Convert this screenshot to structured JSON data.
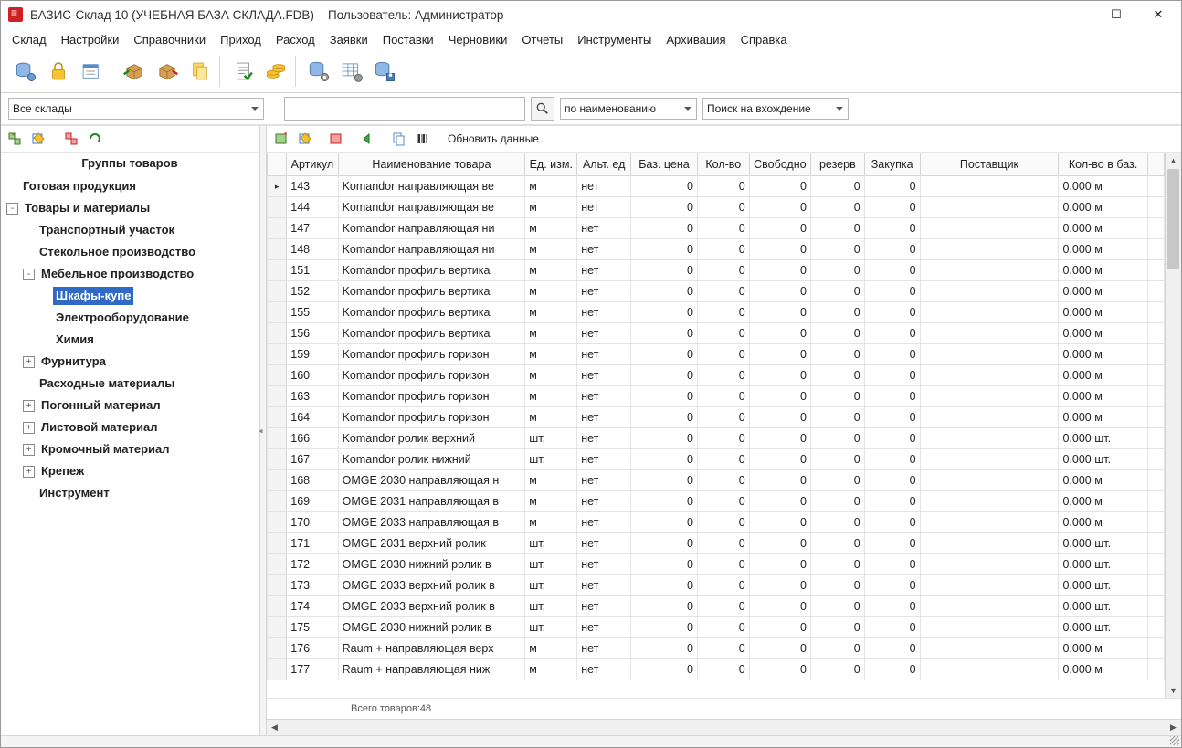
{
  "title_full": "БАЗИС-Склад 10 (УЧЕБНАЯ БАЗА СКЛАДА.FDB)    Пользователь: Администратор",
  "menu": [
    "Склад",
    "Настройки",
    "Справочники",
    "Приход",
    "Расход",
    "Заявки",
    "Поставки",
    "Черновики",
    "Отчеты",
    "Инструменты",
    "Архивация",
    "Справка"
  ],
  "filter": {
    "warehouse": "Все склады",
    "search_value": "",
    "mode": "по наименованию",
    "match": "Поиск на вхождение"
  },
  "tree_title": "Группы товаров",
  "tree": [
    {
      "d": 0,
      "exp": "",
      "label": "Готовая продукция",
      "bold": true
    },
    {
      "d": 0,
      "exp": "-",
      "label": "Товары и материалы",
      "bold": true
    },
    {
      "d": 1,
      "exp": "",
      "label": "Транспортный участок",
      "bold": true
    },
    {
      "d": 1,
      "exp": "",
      "label": "Стекольное производство",
      "bold": true
    },
    {
      "d": 1,
      "exp": "-",
      "label": "Мебельное производство",
      "bold": true
    },
    {
      "d": 2,
      "exp": "",
      "label": "Шкафы-купе",
      "bold": true,
      "sel": true
    },
    {
      "d": 2,
      "exp": "",
      "label": "Электрооборудование",
      "bold": true
    },
    {
      "d": 2,
      "exp": "",
      "label": "Химия",
      "bold": true
    },
    {
      "d": 1,
      "exp": "+",
      "label": "Фурнитура",
      "bold": true
    },
    {
      "d": 1,
      "exp": "",
      "label": "Расходные материалы",
      "bold": true
    },
    {
      "d": 1,
      "exp": "+",
      "label": "Погонный материал",
      "bold": true
    },
    {
      "d": 1,
      "exp": "+",
      "label": "Листовой материал",
      "bold": true
    },
    {
      "d": 1,
      "exp": "+",
      "label": "Кромочный материал",
      "bold": true
    },
    {
      "d": 1,
      "exp": "+",
      "label": "Крепеж",
      "bold": true
    },
    {
      "d": 1,
      "exp": "",
      "label": "Инструмент",
      "bold": true
    }
  ],
  "right_toolbar_refresh": "Обновить данные",
  "columns": [
    "",
    "Артикул",
    "Наименование товара",
    "Ед. изм.",
    "Альт. ед",
    "Баз. цена",
    "Кол-во",
    "Свободно",
    "резерв",
    "Закупка",
    "Поставщик",
    "Кол-во в баз.",
    ""
  ],
  "rows": [
    {
      "art": "143",
      "name": "Komandor направляющая ве",
      "ed": "м",
      "alt": "нет",
      "price": "0",
      "qty": "0",
      "free": "0",
      "res": "0",
      "buy": "0",
      "supp": "",
      "base": "0.000 м",
      "mark": "▸"
    },
    {
      "art": "144",
      "name": "Komandor направляющая ве",
      "ed": "м",
      "alt": "нет",
      "price": "0",
      "qty": "0",
      "free": "0",
      "res": "0",
      "buy": "0",
      "supp": "",
      "base": "0.000 м"
    },
    {
      "art": "147",
      "name": "Komandor направляющая ни",
      "ed": "м",
      "alt": "нет",
      "price": "0",
      "qty": "0",
      "free": "0",
      "res": "0",
      "buy": "0",
      "supp": "",
      "base": "0.000 м"
    },
    {
      "art": "148",
      "name": "Komandor направляющая ни",
      "ed": "м",
      "alt": "нет",
      "price": "0",
      "qty": "0",
      "free": "0",
      "res": "0",
      "buy": "0",
      "supp": "",
      "base": "0.000 м"
    },
    {
      "art": "151",
      "name": "Komandor профиль вертика",
      "ed": "м",
      "alt": "нет",
      "price": "0",
      "qty": "0",
      "free": "0",
      "res": "0",
      "buy": "0",
      "supp": "",
      "base": "0.000 м"
    },
    {
      "art": "152",
      "name": "Komandor профиль вертика",
      "ed": "м",
      "alt": "нет",
      "price": "0",
      "qty": "0",
      "free": "0",
      "res": "0",
      "buy": "0",
      "supp": "",
      "base": "0.000 м"
    },
    {
      "art": "155",
      "name": "Komandor профиль вертика",
      "ed": "м",
      "alt": "нет",
      "price": "0",
      "qty": "0",
      "free": "0",
      "res": "0",
      "buy": "0",
      "supp": "",
      "base": "0.000 м"
    },
    {
      "art": "156",
      "name": "Komandor профиль вертика",
      "ed": "м",
      "alt": "нет",
      "price": "0",
      "qty": "0",
      "free": "0",
      "res": "0",
      "buy": "0",
      "supp": "",
      "base": "0.000 м"
    },
    {
      "art": "159",
      "name": "Komandor профиль горизон",
      "ed": "м",
      "alt": "нет",
      "price": "0",
      "qty": "0",
      "free": "0",
      "res": "0",
      "buy": "0",
      "supp": "",
      "base": "0.000 м"
    },
    {
      "art": "160",
      "name": "Komandor профиль горизон",
      "ed": "м",
      "alt": "нет",
      "price": "0",
      "qty": "0",
      "free": "0",
      "res": "0",
      "buy": "0",
      "supp": "",
      "base": "0.000 м"
    },
    {
      "art": "163",
      "name": "Komandor профиль горизон",
      "ed": "м",
      "alt": "нет",
      "price": "0",
      "qty": "0",
      "free": "0",
      "res": "0",
      "buy": "0",
      "supp": "",
      "base": "0.000 м"
    },
    {
      "art": "164",
      "name": "Komandor профиль горизон",
      "ed": "м",
      "alt": "нет",
      "price": "0",
      "qty": "0",
      "free": "0",
      "res": "0",
      "buy": "0",
      "supp": "",
      "base": "0.000 м"
    },
    {
      "art": "166",
      "name": "Komandor ролик верхний",
      "ed": "шт.",
      "alt": "нет",
      "price": "0",
      "qty": "0",
      "free": "0",
      "res": "0",
      "buy": "0",
      "supp": "",
      "base": "0.000 шт."
    },
    {
      "art": "167",
      "name": "Komandor ролик нижний",
      "ed": "шт.",
      "alt": "нет",
      "price": "0",
      "qty": "0",
      "free": "0",
      "res": "0",
      "buy": "0",
      "supp": "",
      "base": "0.000 шт."
    },
    {
      "art": "168",
      "name": "OMGE 2030 направляющая н",
      "ed": "м",
      "alt": "нет",
      "price": "0",
      "qty": "0",
      "free": "0",
      "res": "0",
      "buy": "0",
      "supp": "",
      "base": "0.000 м"
    },
    {
      "art": "169",
      "name": "OMGE 2031 направляющая в",
      "ed": "м",
      "alt": "нет",
      "price": "0",
      "qty": "0",
      "free": "0",
      "res": "0",
      "buy": "0",
      "supp": "",
      "base": "0.000 м"
    },
    {
      "art": "170",
      "name": "OMGE 2033 направляющая в",
      "ed": "м",
      "alt": "нет",
      "price": "0",
      "qty": "0",
      "free": "0",
      "res": "0",
      "buy": "0",
      "supp": "",
      "base": "0.000 м"
    },
    {
      "art": "171",
      "name": "OMGE 2031 верхний ролик",
      "ed": "шт.",
      "alt": "нет",
      "price": "0",
      "qty": "0",
      "free": "0",
      "res": "0",
      "buy": "0",
      "supp": "",
      "base": "0.000 шт."
    },
    {
      "art": "172",
      "name": "OMGE 2030 нижний ролик в",
      "ed": "шт.",
      "alt": "нет",
      "price": "0",
      "qty": "0",
      "free": "0",
      "res": "0",
      "buy": "0",
      "supp": "",
      "base": "0.000 шт."
    },
    {
      "art": "173",
      "name": "OMGE 2033 верхний ролик в",
      "ed": "шт.",
      "alt": "нет",
      "price": "0",
      "qty": "0",
      "free": "0",
      "res": "0",
      "buy": "0",
      "supp": "",
      "base": "0.000 шт."
    },
    {
      "art": "174",
      "name": "OMGE 2033 верхний ролик в",
      "ed": "шт.",
      "alt": "нет",
      "price": "0",
      "qty": "0",
      "free": "0",
      "res": "0",
      "buy": "0",
      "supp": "",
      "base": "0.000 шт."
    },
    {
      "art": "175",
      "name": "OMGE 2030 нижний ролик в",
      "ed": "шт.",
      "alt": "нет",
      "price": "0",
      "qty": "0",
      "free": "0",
      "res": "0",
      "buy": "0",
      "supp": "",
      "base": "0.000 шт."
    },
    {
      "art": "176",
      "name": "Raum + направляющая верх",
      "ed": "м",
      "alt": "нет",
      "price": "0",
      "qty": "0",
      "free": "0",
      "res": "0",
      "buy": "0",
      "supp": "",
      "base": "0.000 м"
    },
    {
      "art": "177",
      "name": "Raum + направляющая ниж",
      "ed": "м",
      "alt": "нет",
      "price": "0",
      "qty": "0",
      "free": "0",
      "res": "0",
      "buy": "0",
      "supp": "",
      "base": "0.000 м"
    }
  ],
  "status": "Всего товаров:48"
}
